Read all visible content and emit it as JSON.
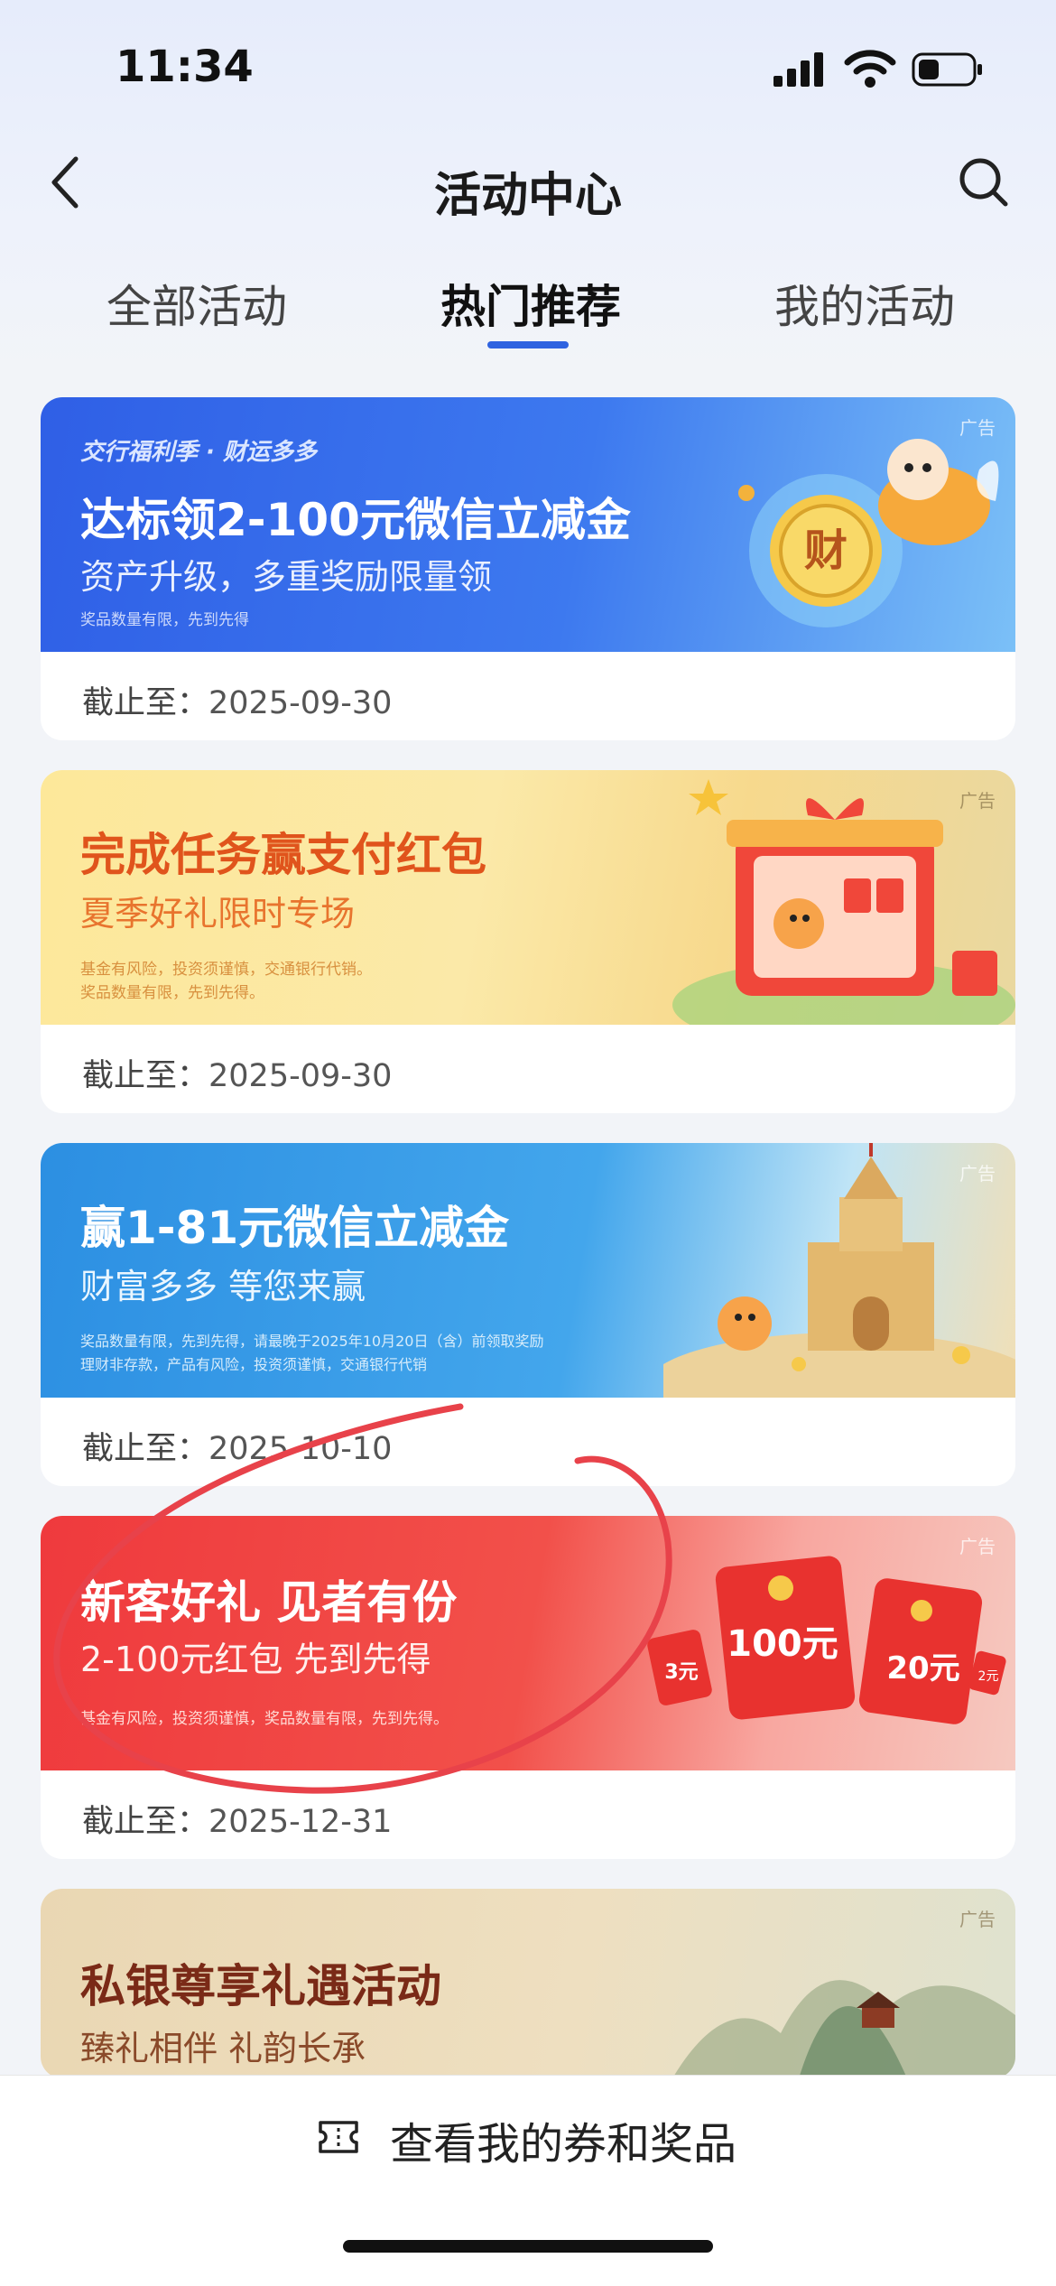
{
  "status": {
    "time": "11:34"
  },
  "nav": {
    "title": "活动中心"
  },
  "tabs": [
    {
      "label": "全部活动"
    },
    {
      "label": "热门推荐"
    },
    {
      "label": "我的活动"
    }
  ],
  "cards": [
    {
      "ad": "广告",
      "brand": "交行福利季 · 财运多多",
      "title": "达标领2-100元微信立减金",
      "subtitle": "资产升级，多重奖励限量领",
      "notes": [
        "奖品数量有限，先到先得"
      ],
      "deco": "财",
      "deadline_label": "截止至：",
      "deadline": "2025-09-30"
    },
    {
      "ad": "广告",
      "title": "完成任务赢支付红包",
      "subtitle": "夏季好礼限时专场",
      "notes": [
        "基金有风险，投资须谨慎，交通银行代销。",
        "奖品数量有限，先到先得。"
      ],
      "deadline_label": "截止至：",
      "deadline": "2025-09-30"
    },
    {
      "ad": "广告",
      "title": "赢1-81元微信立减金",
      "subtitle": "财富多多 等您来赢",
      "notes": [
        "奖品数量有限，先到先得，请最晚于2025年10月20日（含）前领取奖励",
        "理财非存款，产品有风险，投资须谨慎，交通银行代销"
      ],
      "deadline_label": "截止至：",
      "deadline": "2025-10-10"
    },
    {
      "ad": "广告",
      "title": "新客好礼 见者有份",
      "subtitle": "2-100元红包 先到先得",
      "notes": [
        "基金有风险，投资须谨慎，奖品数量有限，先到先得。"
      ],
      "envelopes": [
        "100元",
        "20元",
        "3元",
        "2元"
      ],
      "deadline_label": "截止至：",
      "deadline": "2025-12-31"
    },
    {
      "ad": "广告",
      "title": "私银尊享礼遇活动",
      "subtitle": "臻礼相伴 礼韵长承"
    }
  ],
  "bottom": {
    "label": "查看我的券和奖品"
  },
  "colors": {
    "accent": "#2f63e0",
    "annotation": "#e8424a"
  }
}
